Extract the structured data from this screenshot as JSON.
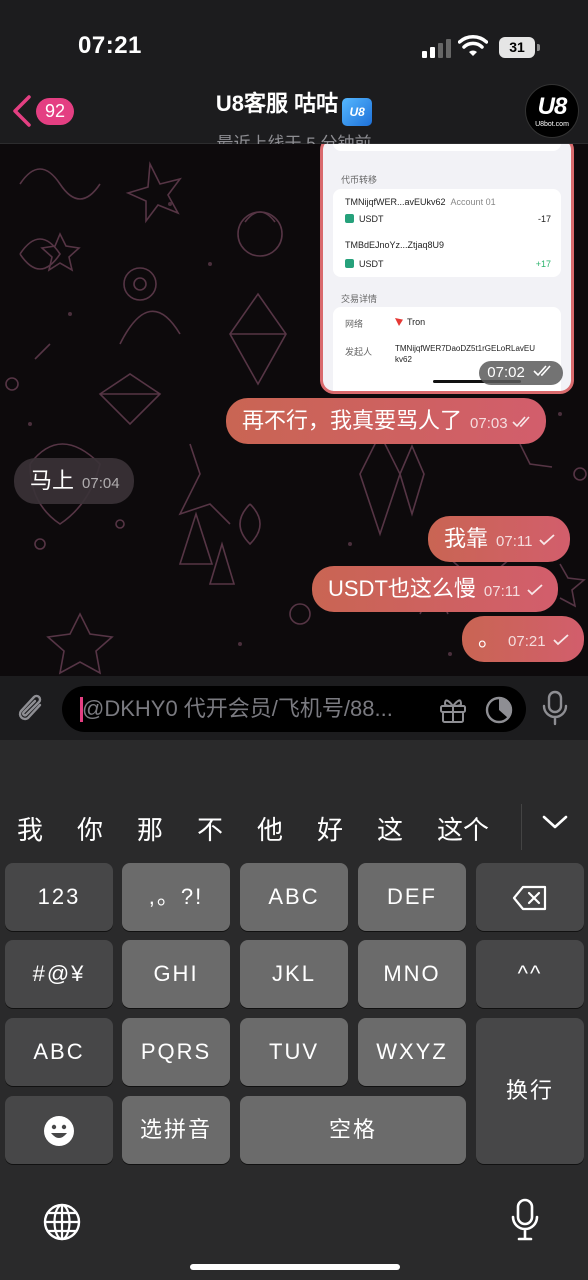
{
  "status_bar": {
    "time": "07:21",
    "battery": "31"
  },
  "header": {
    "unread_count": "92",
    "title": "U8客服 咕咕",
    "verified_badge": "U8",
    "subtitle": "最近上线于 5 分钟前",
    "avatar_logo": "U8",
    "avatar_sub": "U8bot.com"
  },
  "image_message": {
    "section_transfer": "代币转移",
    "row1_address": "TMNijqfWER...avEUkv62",
    "row1_account": "Account 01",
    "row1_token": "USDT",
    "row1_amount": "-17",
    "row2_address": "TMBdEJnoYz...Ztjaq8U9",
    "row2_token": "USDT",
    "row2_amount": "+17",
    "section_details": "交易详情",
    "network_label": "网络",
    "network_value": "Tron",
    "sender_label": "发起人",
    "sender_value_1": "TMNijqfWER7DaoDZ5t1rGELoRLavEU",
    "sender_value_2": "kv62",
    "time": "07:02"
  },
  "messages": [
    {
      "text": "再不行，我真要骂人了",
      "time": "07:03",
      "direction": "out"
    },
    {
      "text": "马上",
      "time": "07:04",
      "direction": "in"
    },
    {
      "text": "我靠",
      "time": "07:11",
      "direction": "out"
    },
    {
      "text": "USDT也这么慢",
      "time": "07:11",
      "direction": "out"
    },
    {
      "text": "。",
      "time": "07:21",
      "direction": "out"
    }
  ],
  "input": {
    "placeholder": "@DKHY0 代开会员/飞机号/88..."
  },
  "keyboard": {
    "candidates": [
      "我",
      "你",
      "那",
      "不",
      "他",
      "好",
      "这",
      "这个"
    ],
    "keys": {
      "num": "123",
      "punct": ",。?!",
      "abc": "ABC",
      "def": "DEF",
      "sym": "#@¥",
      "ghi": "GHI",
      "jkl": "JKL",
      "mno": "MNO",
      "emoticon": "^^",
      "abc2": "ABC",
      "pqrs": "PQRS",
      "tuv": "TUV",
      "wxyz": "WXYZ",
      "return": "换行",
      "pinyin": "选拼音",
      "space": "空格"
    }
  },
  "colors": {
    "accent": "#e43f82",
    "outgoing_bubble": "#d25e6c",
    "keyboard_bg": "#2a2a2b"
  }
}
